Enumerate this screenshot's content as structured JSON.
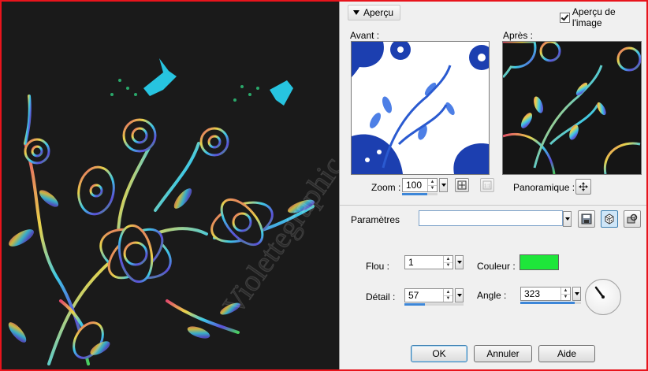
{
  "header": {
    "apercu_label": "Aperçu",
    "apercu_image_label": "Aperçu de l'image"
  },
  "previews": {
    "before_label": "Avant :",
    "after_label": "Après :"
  },
  "zoom": {
    "label": "Zoom :",
    "value": "100",
    "level": 1.0
  },
  "panoramique": {
    "label": "Panoramique :"
  },
  "parametres": {
    "label": "Paramètres",
    "value": ""
  },
  "flou": {
    "label": "Flou :",
    "value": "1"
  },
  "detail": {
    "label": "Détail :",
    "value": "57",
    "level": 0.57
  },
  "couleur": {
    "label": "Couleur :",
    "color": "#1ee63a"
  },
  "angle": {
    "label": "Angle :",
    "value": "323",
    "level": 0.897
  },
  "buttons": {
    "ok": "OK",
    "annuler": "Annuler",
    "aide": "Aide"
  },
  "watermark": "Violettegraphic",
  "colors": {
    "frame": "#e8141c",
    "canvas": "#1a1a1a",
    "accent": "#3c86d8"
  }
}
